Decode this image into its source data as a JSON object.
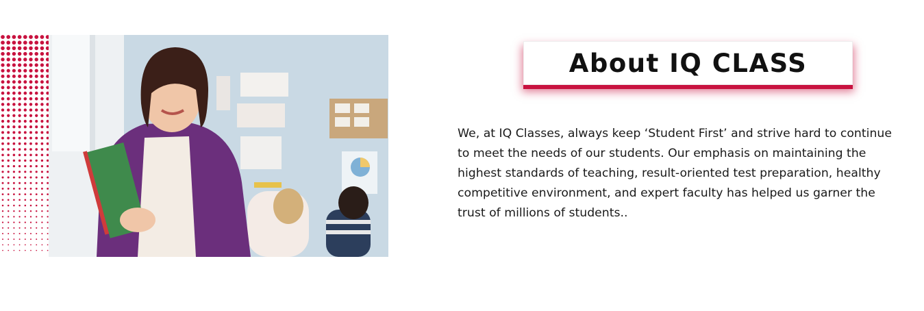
{
  "about": {
    "heading": "About IQ CLASS",
    "paragraph": "We, at IQ Classes, always keep ‘Student First’ and strive hard to continue to meet the needs of our students. Our emphasis on maintaining the highest standards of teaching, result-oriented test preparation, healthy competitive environment, and expert faculty has helped us garner the trust of millions of students.."
  },
  "colors": {
    "accent": "#c8123f",
    "text": "#1a1a1a"
  },
  "image": {
    "icon": "teacher-classroom-photo"
  }
}
